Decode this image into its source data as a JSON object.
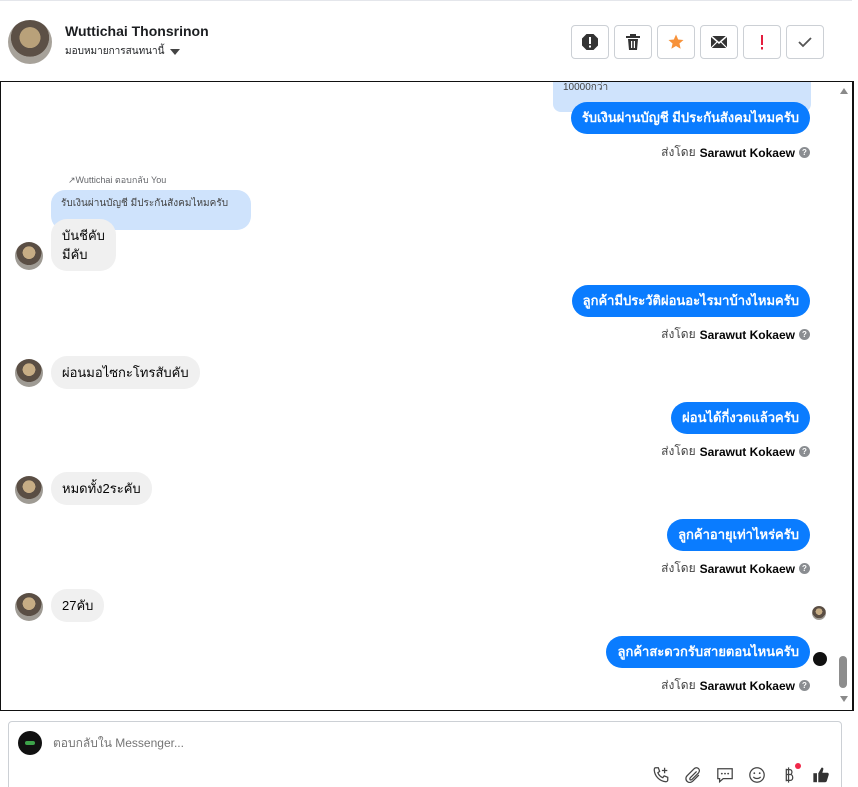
{
  "header": {
    "name": "Wuttichai Thonsrinon",
    "assign_label": "มอบหมายการสนทนานี้"
  },
  "actions": [
    {
      "icon": "spam-alert-icon"
    },
    {
      "icon": "trash-icon"
    },
    {
      "icon": "star-icon",
      "color": "#f7923a"
    },
    {
      "icon": "envelope-icon"
    },
    {
      "icon": "exclamation-icon",
      "color": "#e41e3f"
    },
    {
      "icon": "checkmark-icon"
    }
  ],
  "messages": {
    "top_cut_text": "10000กว่า",
    "m1": {
      "text": "รับเงินผ่านบัญชี มีประกันสังคมไหมครับ",
      "sent_by_prefix": "ส่งโดย",
      "sender": "Sarawut Kokaew"
    },
    "reply_note": "Wuttichai ตอบกลับ You",
    "quoted_text": "รับเงินผ่านบัญชี มีประกันสังคมไหมครับ",
    "in1_line1": "บันชีคับ",
    "in1_line2": "มีคับ",
    "m2": {
      "text": "ลูกค้ามีประวัติผ่อนอะไรมาบ้างไหมครับ",
      "sent_by_prefix": "ส่งโดย",
      "sender": "Sarawut Kokaew"
    },
    "in2": "ผ่อนมอไซกะโทรสับคับ",
    "m3": {
      "text": "ผ่อนได้กี่งวดแล้วครับ",
      "sent_by_prefix": "ส่งโดย",
      "sender": "Sarawut Kokaew"
    },
    "in3": "หมดทั้ง2ระคับ",
    "m4": {
      "text": "ลูกค้าอายุเท่าไหร่ครับ",
      "sent_by_prefix": "ส่งโดย",
      "sender": "Sarawut Kokaew"
    },
    "in4": "27คับ",
    "m5": {
      "text": "ลูกค้าสะดวกรับสายตอนไหนครับ",
      "sent_by_prefix": "ส่งโดย",
      "sender": "Sarawut Kokaew"
    }
  },
  "composer": {
    "placeholder": "ตอบกลับใน Messenger...",
    "tools": [
      "call-add-icon",
      "attachment-icon",
      "saved-reply-icon",
      "emoji-icon",
      "baht-payment-icon",
      "thumbs-up-icon"
    ]
  },
  "colors": {
    "outgoing_bubble": "#0a7cff",
    "incoming_bubble": "#f0f0f0",
    "quoted_bubble": "#cfe3fc"
  }
}
